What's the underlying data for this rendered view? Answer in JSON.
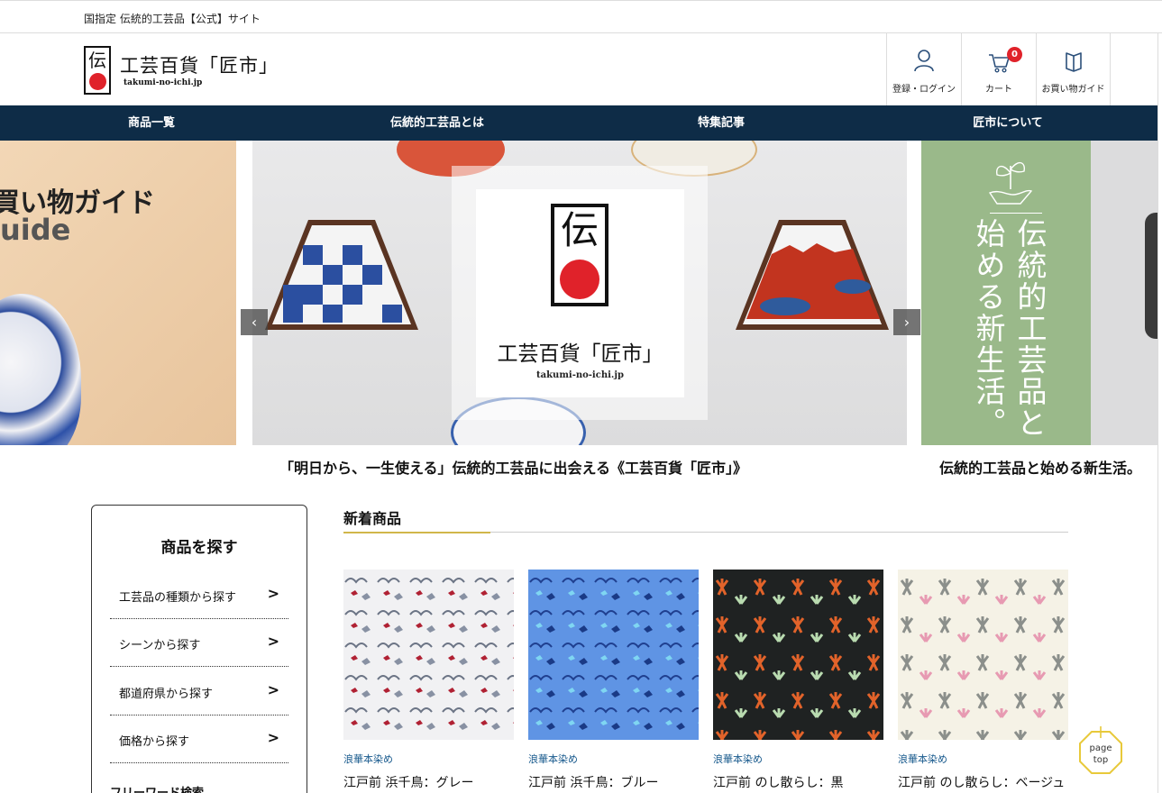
{
  "topbar": {
    "text": "国指定 伝統的工芸品【公式】サイト"
  },
  "brand": {
    "mark_char": "伝",
    "name": "工芸百貨「匠市」",
    "url": "takumi-no-ichi.jp",
    "accent_red": "#e0222a"
  },
  "header_buttons": [
    {
      "label": "登録・ログイン",
      "icon": "user-icon"
    },
    {
      "label": "カート",
      "icon": "cart-icon",
      "badge": "0"
    },
    {
      "label": "お買い物ガイド",
      "icon": "book-icon"
    }
  ],
  "nav": {
    "background": "#0e2c47",
    "items": [
      "商品一覧",
      "伝統的工芸品とは",
      "特集記事",
      "匠市について"
    ]
  },
  "slider": {
    "left": {
      "line1": "買い物ガイド",
      "line2": "uide"
    },
    "main": {
      "mark_char": "伝",
      "name": "工芸百貨「匠市」",
      "url": "takumi-no-ichi.jp"
    },
    "right": {
      "col1": "伝統的工芸品と",
      "col2": "始める新生活。",
      "bg": "#9ab98a"
    },
    "prev": "‹",
    "next": "›",
    "captions": [
      "「明日から、一生使える」伝統的工芸品に出会える《工芸百貨「匠市」》",
      "伝統的工芸品と始める新生活。"
    ]
  },
  "sidebar": {
    "title": "商品を探す",
    "items": [
      {
        "label": "工芸品の種類から探す"
      },
      {
        "label": "シーンから探す"
      },
      {
        "label": "都道府県から探す"
      },
      {
        "label": "価格から探す"
      }
    ],
    "freeword": "フリーワード検索"
  },
  "new_arrivals": {
    "title": "新着商品",
    "accent": "#d1b64a",
    "products": [
      {
        "category": "浪華本染め",
        "name": "江戸前 浜千鳥：グレー"
      },
      {
        "category": "浪華本染め",
        "name": "江戸前 浜千鳥：ブルー"
      },
      {
        "category": "浪華本染め",
        "name": "江戸前 のし散らし：黒"
      },
      {
        "category": "浪華本染め",
        "name": "江戸前 のし散らし：ベージュ"
      }
    ]
  },
  "page_top": {
    "line1": "page",
    "line2": "top"
  }
}
